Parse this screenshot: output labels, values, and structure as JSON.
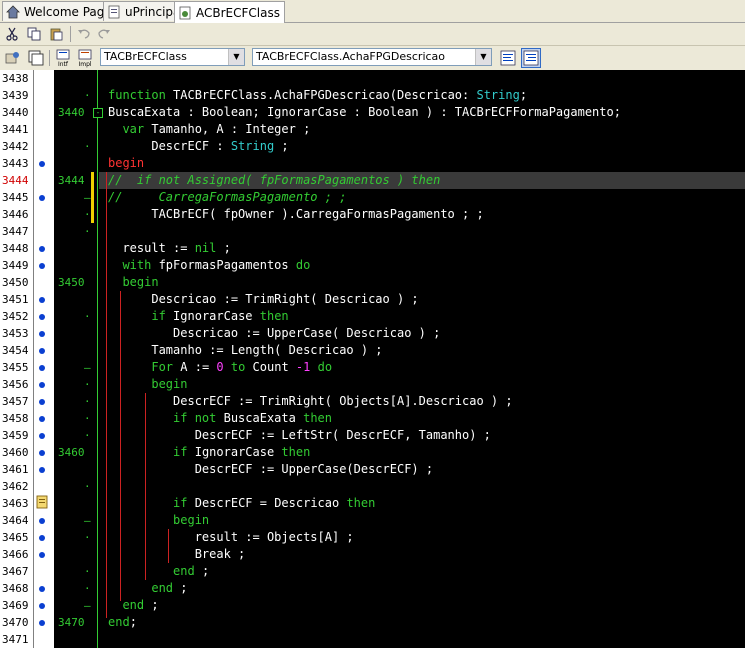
{
  "tabs": [
    {
      "label": "Welcome Page"
    },
    {
      "label": "uPrincipal"
    },
    {
      "label": "ACBrECFClass"
    }
  ],
  "toolbar": {
    "class_combo": "TACBrECFClass",
    "method_combo": "TACBrECFClass.AchaFPGDescricao",
    "intf_label": "Intf",
    "impl_label": "Impl"
  },
  "editor": {
    "lines": [
      {
        "n": "3438",
        "fold": "",
        "code": []
      },
      {
        "n": "3439",
        "fold": "",
        "code": [
          [
            "kw",
            "function "
          ],
          [
            "",
            "TACBrECFClass.AchaFPGDescricao(Descricao: "
          ],
          [
            "typ",
            "String"
          ],
          [
            "",
            ";"
          ]
        ]
      },
      {
        "n": "3440",
        "fold": "3440",
        "code": [
          [
            "",
            ""
          ],
          [
            "",
            "BuscaExata : Boolean; IgnorarCase : Boolean ) : TACBrECFFormaPagamento;"
          ]
        ]
      },
      {
        "n": "3441",
        "fold": "",
        "code": [
          [
            "",
            "  "
          ],
          [
            "kw",
            "var "
          ],
          [
            "",
            "Tamanho, A : Integer ;"
          ]
        ]
      },
      {
        "n": "3442",
        "fold": "",
        "code": [
          [
            "",
            "      DescrECF : "
          ],
          [
            "typ",
            "String"
          ],
          [
            "",
            " ;"
          ]
        ]
      },
      {
        "n": "3443",
        "fold": "",
        "code": [
          [
            "red",
            "begin"
          ]
        ]
      },
      {
        "n": "3444",
        "fold": "3444",
        "code": [
          [
            "cm",
            "//  if not Assigned( fpFormasPagamentos ) then"
          ]
        ]
      },
      {
        "n": "3445",
        "fold": "",
        "code": [
          [
            "cm",
            "//     CarregaFormasPagamento ; ;"
          ]
        ]
      },
      {
        "n": "3446",
        "fold": "",
        "code": [
          [
            "",
            "      TACBrECF( fpOwner ).CarregaFormasPagamento ; ;"
          ]
        ]
      },
      {
        "n": "3447",
        "fold": "",
        "code": []
      },
      {
        "n": "3448",
        "fold": "",
        "code": [
          [
            "",
            "  result := "
          ],
          [
            "kw",
            "nil"
          ],
          [
            "",
            " ;"
          ]
        ]
      },
      {
        "n": "3449",
        "fold": "",
        "code": [
          [
            "",
            "  "
          ],
          [
            "kw",
            "with "
          ],
          [
            "",
            "fpFormasPagamentos "
          ],
          [
            "kw",
            "do"
          ]
        ]
      },
      {
        "n": "3450",
        "fold": "3450",
        "code": [
          [
            "",
            "  "
          ],
          [
            "kw",
            "begin"
          ]
        ]
      },
      {
        "n": "3451",
        "fold": "",
        "code": [
          [
            "",
            "      Descricao := TrimRight( Descricao ) ;"
          ]
        ]
      },
      {
        "n": "3452",
        "fold": "",
        "code": [
          [
            "",
            "      "
          ],
          [
            "kw",
            "if "
          ],
          [
            "",
            "IgnorarCase "
          ],
          [
            "kw",
            "then"
          ]
        ]
      },
      {
        "n": "3453",
        "fold": "",
        "code": [
          [
            "",
            "         Descricao := UpperCase( Descricao ) ;"
          ]
        ]
      },
      {
        "n": "3454",
        "fold": "",
        "code": [
          [
            "",
            "      Tamanho := Length( Descricao ) ;"
          ]
        ]
      },
      {
        "n": "3455",
        "fold": "",
        "code": [
          [
            "",
            "      "
          ],
          [
            "kw",
            "For "
          ],
          [
            "",
            "A := "
          ],
          [
            "num",
            "0"
          ],
          [
            "",
            " "
          ],
          [
            "kw",
            "to "
          ],
          [
            "",
            "Count "
          ],
          [
            "num",
            "-1"
          ],
          [
            "",
            " "
          ],
          [
            "kw",
            "do"
          ]
        ]
      },
      {
        "n": "3456",
        "fold": "",
        "code": [
          [
            "",
            "      "
          ],
          [
            "kw",
            "begin"
          ]
        ]
      },
      {
        "n": "3457",
        "fold": "",
        "code": [
          [
            "",
            "         DescrECF := TrimRight( Objects[A].Descricao ) ;"
          ]
        ]
      },
      {
        "n": "3458",
        "fold": "",
        "code": [
          [
            "",
            "         "
          ],
          [
            "kw",
            "if not "
          ],
          [
            "",
            "BuscaExata "
          ],
          [
            "kw",
            "then"
          ]
        ]
      },
      {
        "n": "3459",
        "fold": "",
        "code": [
          [
            "",
            "            DescrECF := LeftStr( DescrECF, Tamanho) ;"
          ]
        ]
      },
      {
        "n": "3460",
        "fold": "3460",
        "code": [
          [
            "",
            "         "
          ],
          [
            "kw",
            "if "
          ],
          [
            "",
            "IgnorarCase "
          ],
          [
            "kw",
            "then"
          ]
        ]
      },
      {
        "n": "3461",
        "fold": "",
        "code": [
          [
            "",
            "            DescrECF := UpperCase(DescrECF) ;"
          ]
        ]
      },
      {
        "n": "3462",
        "fold": "",
        "code": []
      },
      {
        "n": "3463",
        "fold": "",
        "code": [
          [
            "",
            "         "
          ],
          [
            "kw",
            "if "
          ],
          [
            "",
            "DescrECF = Descricao "
          ],
          [
            "kw",
            "then"
          ]
        ]
      },
      {
        "n": "3464",
        "fold": "",
        "code": [
          [
            "",
            "         "
          ],
          [
            "kw",
            "begin"
          ]
        ]
      },
      {
        "n": "3465",
        "fold": "",
        "code": [
          [
            "",
            "            result := Objects[A] ;"
          ]
        ]
      },
      {
        "n": "3466",
        "fold": "",
        "code": [
          [
            "",
            "            Break ;"
          ]
        ]
      },
      {
        "n": "3467",
        "fold": "",
        "code": [
          [
            "",
            "         "
          ],
          [
            "kw",
            "end"
          ],
          [
            "",
            " ;"
          ]
        ]
      },
      {
        "n": "3468",
        "fold": "",
        "code": [
          [
            "",
            "      "
          ],
          [
            "kw",
            "end"
          ],
          [
            "",
            " ;"
          ]
        ]
      },
      {
        "n": "3469",
        "fold": "",
        "code": [
          [
            "",
            "  "
          ],
          [
            "kw",
            "end"
          ],
          [
            "",
            " ;"
          ]
        ]
      },
      {
        "n": "3470",
        "fold": "3470",
        "code": [
          [
            "kw",
            "end"
          ],
          [
            "",
            ";"
          ]
        ]
      },
      {
        "n": "3471",
        "fold": "",
        "code": []
      }
    ]
  }
}
